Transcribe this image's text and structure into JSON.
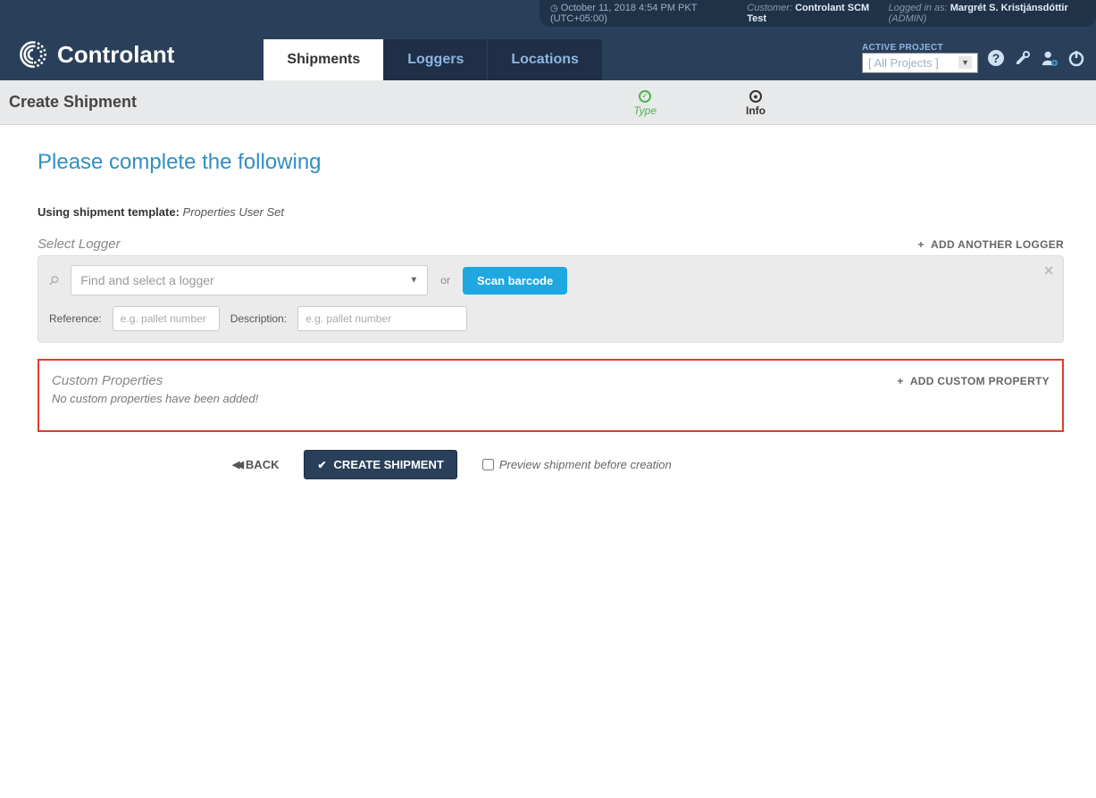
{
  "topbar": {
    "datetime": "October 11, 2018 4:54 PM PKT (UTC+05:00)",
    "customer_label": "Customer:",
    "customer_name": "Controlant SCM Test",
    "logged_in_label": "Logged in as:",
    "user_name": "Margrét S. Kristjánsdóttir",
    "user_role": "(ADMIN)"
  },
  "brand": "Controlant",
  "nav": {
    "tabs": [
      "Shipments",
      "Loggers",
      "Locations"
    ],
    "active_project_label": "ACTIVE PROJECT",
    "project_selected": "[ All Projects ]"
  },
  "page": {
    "title": "Create Shipment",
    "steps": {
      "type": "Type",
      "info": "Info"
    }
  },
  "subtitle": "Please complete the following",
  "template": {
    "label": "Using shipment template:",
    "value": "Properties User Set"
  },
  "logger": {
    "section_label": "Select Logger",
    "add_another": "ADD ANOTHER LOGGER",
    "placeholder": "Find and select a logger",
    "or": "or",
    "scan": "Scan barcode",
    "reference_label": "Reference:",
    "reference_ph": "e.g. pallet number",
    "description_label": "Description:",
    "description_ph": "e.g. pallet number"
  },
  "custom": {
    "title": "Custom Properties",
    "add": "ADD CUSTOM PROPERTY",
    "empty": "No custom properties have been added!"
  },
  "actions": {
    "back": "BACK",
    "create": "CREATE SHIPMENT",
    "preview": "Preview shipment before creation"
  }
}
